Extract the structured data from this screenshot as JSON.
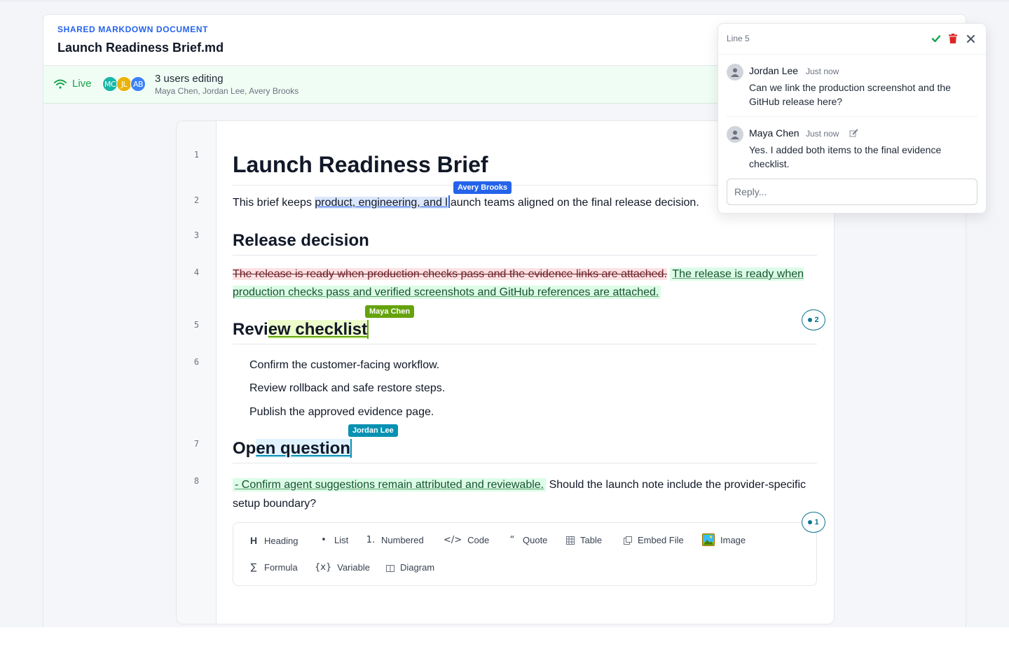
{
  "header": {
    "kicker": "SHARED MARKDOWN DOCUMENT",
    "title": "Launch Readiness Brief.md"
  },
  "presence": {
    "status": "Live",
    "avatars": [
      {
        "initials": "MC",
        "color": "#14b8a6"
      },
      {
        "initials": "JL",
        "color": "#eab308"
      },
      {
        "initials": "AB",
        "color": "#3b82f6"
      }
    ],
    "count_label": "3 users editing",
    "names": "Maya Chen, Jordan Lee, Avery Brooks"
  },
  "editor": {
    "line_numbers": [
      "1",
      "2",
      "3",
      "4",
      "5",
      "6",
      "7",
      "8"
    ],
    "h1": "Launch Readiness Brief",
    "p1": {
      "before": "This brief keeps ",
      "selected": "product, engineering, and l",
      "after": "aunch teams aligned on the final release decision."
    },
    "h2_release": "Release decision",
    "p_change": {
      "deleted": "The release is ready when production checks pass and the evidence links are attached.",
      "inserted": "The release is ready when production checks pass and verified screenshots and GitHub references are attached."
    },
    "h2_review": {
      "before": "Revi",
      "highlighted": "ew checklist"
    },
    "list": [
      "Confirm the customer-facing workflow.",
      "Review rollback and safe restore steps.",
      "Publish the approved evidence page."
    ],
    "h2_open": {
      "before": "Op",
      "highlighted": "en question"
    },
    "p_last": {
      "inserted": "- Confirm agent suggestions remain attributed and reviewable.",
      "after": " Should the launch note include the provider-specific setup boundary?"
    },
    "cursors": [
      {
        "name": "Avery Brooks",
        "color": "#2563eb"
      },
      {
        "name": "Maya Chen",
        "color": "#65a30d"
      },
      {
        "name": "Jordan Lee",
        "color": "#0891b2"
      }
    ],
    "comment_counts": [
      "2",
      "1"
    ]
  },
  "toolbar": {
    "items": [
      {
        "icon": "H",
        "label": "Heading"
      },
      {
        "icon": "•",
        "label": "List"
      },
      {
        "icon": "1.",
        "label": "Numbered"
      },
      {
        "icon": "</>",
        "label": "Code"
      },
      {
        "icon": "“",
        "label": "Quote"
      },
      {
        "icon": "table-icon",
        "label": "Table"
      },
      {
        "icon": "embed-icon",
        "label": "Embed File"
      },
      {
        "icon": "image-icon",
        "label": "Image"
      },
      {
        "icon": "∑",
        "label": "Formula"
      },
      {
        "icon": "{x}",
        "label": "Variable"
      },
      {
        "icon": "diagram-icon",
        "label": "Diagram"
      }
    ]
  },
  "comments_popover": {
    "line_label": "Line 5",
    "comments": [
      {
        "author": "Jordan Lee",
        "time": "Just now",
        "text": "Can we link the production screenshot and the GitHub release here?"
      },
      {
        "author": "Maya Chen",
        "time": "Just now",
        "text": "Yes. I added both items to the final evidence checklist."
      }
    ],
    "reply_placeholder": "Reply...",
    "colors": {
      "resolve": "#16a34a",
      "delete": "#dc2626"
    }
  }
}
